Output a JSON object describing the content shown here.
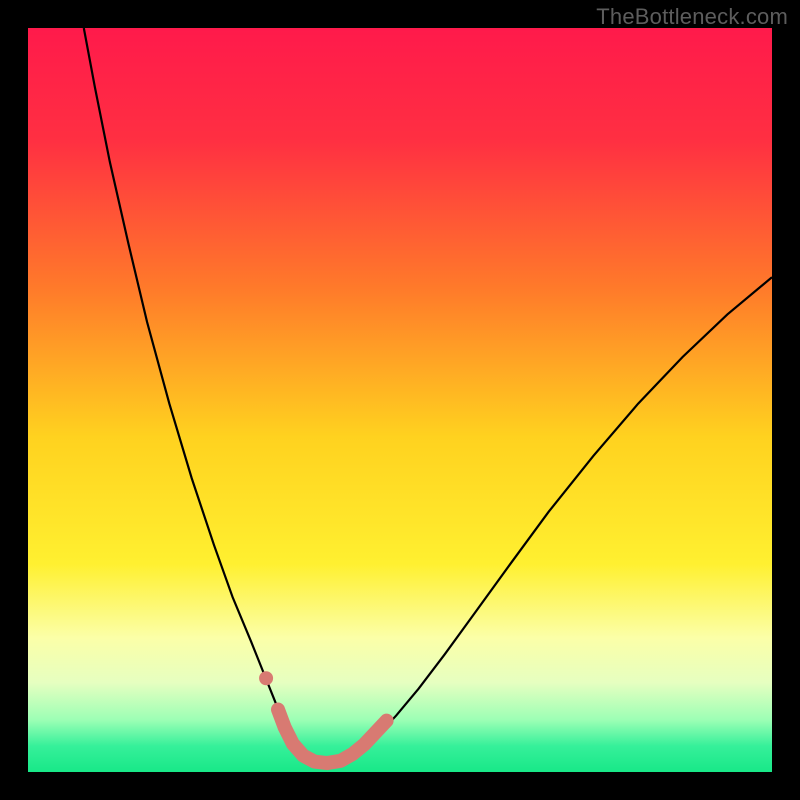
{
  "watermark": "TheBottleneck.com",
  "chart_data": {
    "type": "line",
    "title": "",
    "xlabel": "",
    "ylabel": "",
    "xlim": [
      0,
      100
    ],
    "ylim": [
      0,
      100
    ],
    "background_gradient": {
      "stops": [
        {
          "offset": 0.0,
          "color": "#ff1a4b"
        },
        {
          "offset": 0.15,
          "color": "#ff2f42"
        },
        {
          "offset": 0.35,
          "color": "#ff7a2a"
        },
        {
          "offset": 0.55,
          "color": "#ffd21f"
        },
        {
          "offset": 0.72,
          "color": "#fff030"
        },
        {
          "offset": 0.82,
          "color": "#fbffa8"
        },
        {
          "offset": 0.88,
          "color": "#e6ffc0"
        },
        {
          "offset": 0.93,
          "color": "#9cffb5"
        },
        {
          "offset": 0.965,
          "color": "#36f09a"
        },
        {
          "offset": 1.0,
          "color": "#18e888"
        }
      ]
    },
    "series": [
      {
        "name": "bottleneck-curve",
        "color": "#000000",
        "width": 2.2,
        "points": [
          {
            "x": 7.5,
            "y": 100.0
          },
          {
            "x": 9.0,
            "y": 92.0
          },
          {
            "x": 11.0,
            "y": 82.0
          },
          {
            "x": 13.5,
            "y": 71.0
          },
          {
            "x": 16.0,
            "y": 60.5
          },
          {
            "x": 19.0,
            "y": 49.5
          },
          {
            "x": 22.0,
            "y": 39.5
          },
          {
            "x": 25.0,
            "y": 30.5
          },
          {
            "x": 27.5,
            "y": 23.5
          },
          {
            "x": 30.0,
            "y": 17.5
          },
          {
            "x": 32.0,
            "y": 12.5
          },
          {
            "x": 33.2,
            "y": 9.5
          },
          {
            "x": 34.2,
            "y": 7.0
          },
          {
            "x": 35.2,
            "y": 4.8
          },
          {
            "x": 36.2,
            "y": 3.0
          },
          {
            "x": 37.5,
            "y": 1.6
          },
          {
            "x": 39.0,
            "y": 0.9
          },
          {
            "x": 41.0,
            "y": 0.9
          },
          {
            "x": 43.0,
            "y": 1.6
          },
          {
            "x": 45.0,
            "y": 3.0
          },
          {
            "x": 47.0,
            "y": 4.9
          },
          {
            "x": 49.5,
            "y": 7.6
          },
          {
            "x": 52.5,
            "y": 11.2
          },
          {
            "x": 56.0,
            "y": 15.8
          },
          {
            "x": 60.0,
            "y": 21.3
          },
          {
            "x": 65.0,
            "y": 28.2
          },
          {
            "x": 70.0,
            "y": 35.0
          },
          {
            "x": 76.0,
            "y": 42.5
          },
          {
            "x": 82.0,
            "y": 49.5
          },
          {
            "x": 88.0,
            "y": 55.8
          },
          {
            "x": 94.0,
            "y": 61.5
          },
          {
            "x": 100.0,
            "y": 66.5
          }
        ]
      },
      {
        "name": "highlight-segment",
        "color": "#d87a72",
        "width": 14,
        "linecap": "round",
        "points": [
          {
            "x": 33.6,
            "y": 8.4
          },
          {
            "x": 34.5,
            "y": 6.0
          },
          {
            "x": 35.6,
            "y": 3.8
          },
          {
            "x": 37.0,
            "y": 2.2
          },
          {
            "x": 38.5,
            "y": 1.4
          },
          {
            "x": 40.2,
            "y": 1.2
          },
          {
            "x": 42.0,
            "y": 1.5
          },
          {
            "x": 43.6,
            "y": 2.4
          },
          {
            "x": 45.2,
            "y": 3.7
          },
          {
            "x": 46.7,
            "y": 5.3
          },
          {
            "x": 48.2,
            "y": 6.9
          }
        ]
      }
    ],
    "markers": [
      {
        "name": "highlight-dot",
        "x": 32.0,
        "y": 12.6,
        "r": 7,
        "color": "#d87a72"
      }
    ]
  }
}
